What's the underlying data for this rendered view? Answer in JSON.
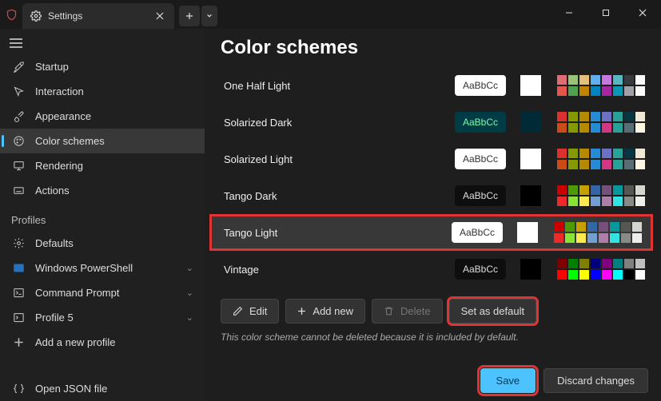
{
  "titlebar": {
    "tab_title": "Settings"
  },
  "sidebar": {
    "items": [
      {
        "label": "Startup"
      },
      {
        "label": "Interaction"
      },
      {
        "label": "Appearance"
      },
      {
        "label": "Color schemes"
      },
      {
        "label": "Rendering"
      },
      {
        "label": "Actions"
      }
    ],
    "profiles_label": "Profiles",
    "profiles": [
      {
        "label": "Defaults"
      },
      {
        "label": "Windows PowerShell"
      },
      {
        "label": "Command Prompt"
      },
      {
        "label": "Profile 5"
      }
    ],
    "add_profile": "Add a new profile",
    "open_json": "Open JSON file"
  },
  "main": {
    "title": "Color schemes",
    "preview_text": "AaBbCc",
    "schemes": [
      {
        "name": "One Half Light",
        "bg": "light"
      },
      {
        "name": "Solarized Dark",
        "bg": "sol"
      },
      {
        "name": "Solarized Light",
        "bg": "light"
      },
      {
        "name": "Tango Dark",
        "bg": "dark"
      },
      {
        "name": "Tango Light",
        "bg": "light"
      },
      {
        "name": "Vintage",
        "bg": "dark"
      }
    ],
    "toolbar": {
      "edit": "Edit",
      "add": "Add new",
      "delete": "Delete",
      "default": "Set as default"
    },
    "note": "This color scheme cannot be deleted because it is included by default.",
    "save": "Save",
    "discard": "Discard changes"
  },
  "palettes": {
    "one_half_light": [
      [
        "#e06c75",
        "#98c379",
        "#e5c07b",
        "#61afef",
        "#c678dd",
        "#56b6c2",
        "#383a42",
        "#fafafa"
      ],
      [
        "#e45649",
        "#50a14f",
        "#c18401",
        "#0184bc",
        "#a626a4",
        "#0997b3",
        "#a0a1a7",
        "#fafafa"
      ]
    ],
    "solarized": [
      [
        "#dc322f",
        "#859900",
        "#b58900",
        "#268bd2",
        "#6c71c4",
        "#2aa198",
        "#073642",
        "#eee8d5"
      ],
      [
        "#cb4b16",
        "#859900",
        "#b58900",
        "#268bd2",
        "#d33682",
        "#2aa198",
        "#586e75",
        "#fdf6e3"
      ]
    ],
    "tango": [
      [
        "#cc0000",
        "#4e9a06",
        "#c4a000",
        "#3465a4",
        "#75507b",
        "#06989a",
        "#555753",
        "#d3d7cf"
      ],
      [
        "#ef2929",
        "#8ae234",
        "#fce94f",
        "#729fcf",
        "#ad7fa8",
        "#34e2e2",
        "#888a85",
        "#eeeeec"
      ]
    ],
    "vintage": [
      [
        "#800000",
        "#008000",
        "#808000",
        "#000080",
        "#800080",
        "#008080",
        "#808080",
        "#c0c0c0"
      ],
      [
        "#ff0000",
        "#00ff00",
        "#ffff00",
        "#0000ff",
        "#ff00ff",
        "#00ffff",
        "#000000",
        "#ffffff"
      ]
    ]
  }
}
